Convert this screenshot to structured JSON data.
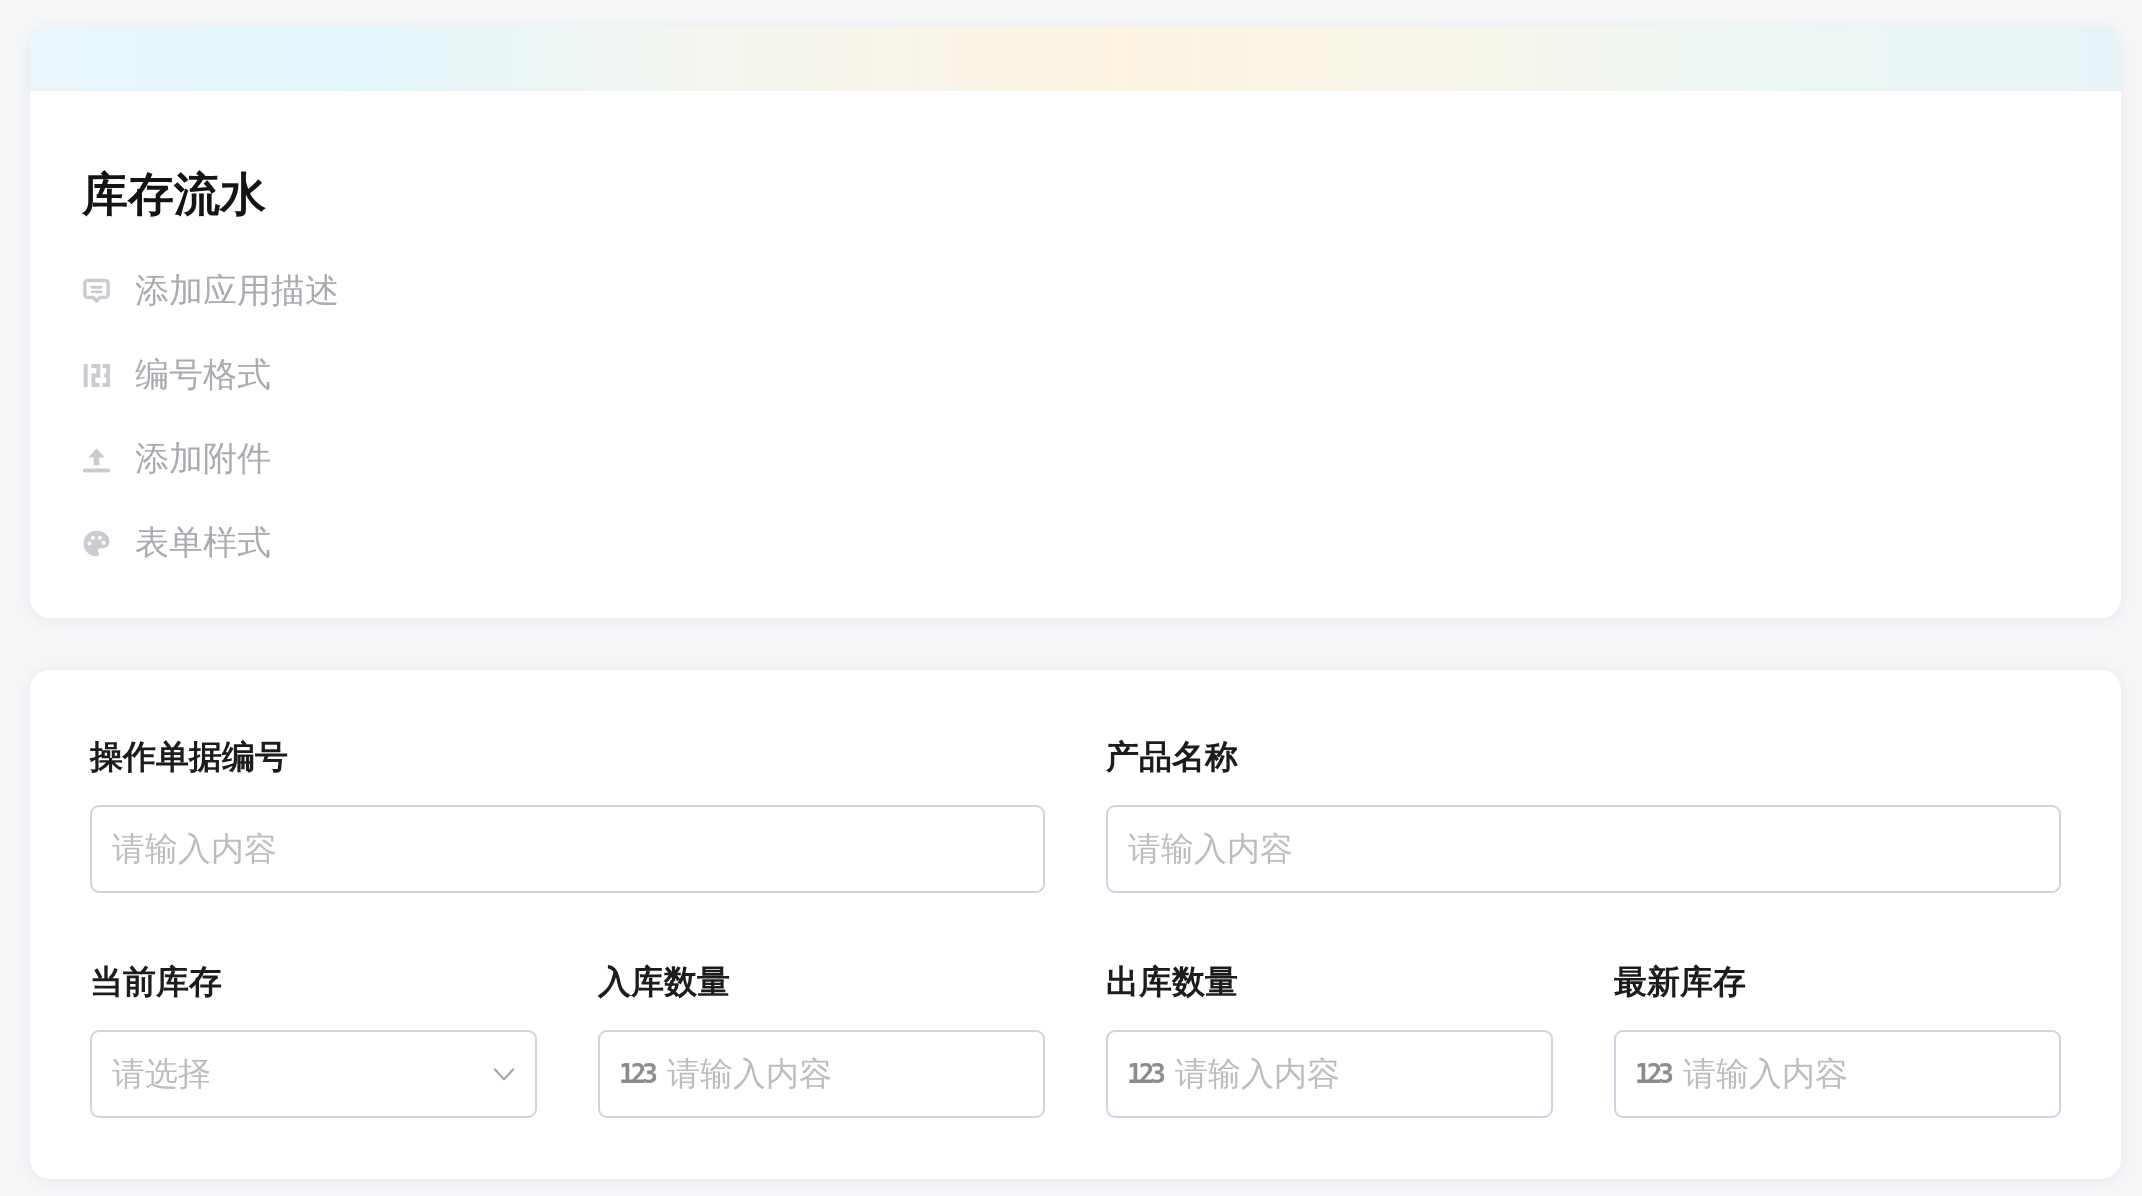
{
  "form_header": {
    "title": "库存流水",
    "actions": [
      {
        "kind": "description",
        "label": "添加应用描述"
      },
      {
        "kind": "numbering",
        "label": "编号格式"
      },
      {
        "kind": "attachment",
        "label": "添加附件"
      },
      {
        "kind": "style",
        "label": "表单样式"
      }
    ]
  },
  "form": {
    "fields": [
      {
        "kind": "text",
        "label": "操作单据编号",
        "placeholder": "请输入内容"
      },
      {
        "kind": "text",
        "label": "产品名称",
        "placeholder": "请输入内容"
      },
      {
        "kind": "select",
        "label": "当前库存",
        "placeholder": "请选择"
      },
      {
        "kind": "number",
        "label": "入库数量",
        "prefix": "123",
        "placeholder": "请输入内容"
      },
      {
        "kind": "number",
        "label": "出库数量",
        "prefix": "123",
        "placeholder": "请输入内容"
      },
      {
        "kind": "number",
        "label": "最新库存",
        "prefix": "123",
        "placeholder": "请输入内容"
      }
    ]
  }
}
